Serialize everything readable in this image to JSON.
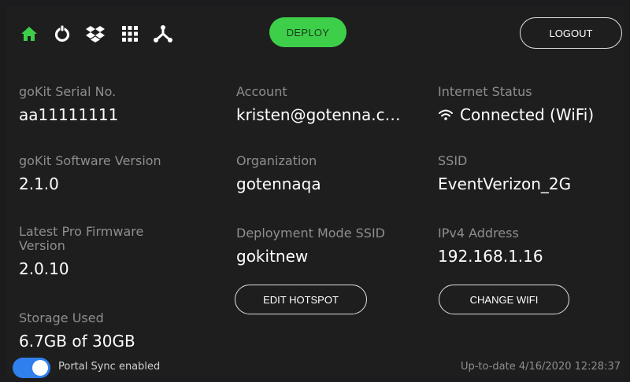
{
  "nav": {
    "icons": [
      "home-icon",
      "power-icon",
      "dropbox-icon",
      "grid-icon",
      "network-icon"
    ],
    "active_color": "#3ecf4a"
  },
  "deploy_label": "DEPLOY",
  "logout_label": "LOGOUT",
  "fields": {
    "serial_label": "goKit Serial No.",
    "serial_value": "aa11111111",
    "software_label": "goKit Software Version",
    "software_value": "2.1.0",
    "firmware_label": "Latest Pro Firmware Version",
    "firmware_value": "2.0.10",
    "storage_label": "Storage Used",
    "storage_value": "6.7GB of 30GB",
    "account_label": "Account",
    "account_value": "kristen@gotenna.c…",
    "org_label": "Organization",
    "org_value": "gotennaqa",
    "ssid_mode_label": "Deployment Mode SSID",
    "ssid_mode_value": "gokitnew",
    "internet_label": "Internet Status",
    "internet_value": "Connected (WiFi)",
    "ssid_label": "SSID",
    "ssid_value": "EventVerizon_2G",
    "ipv4_label": "IPv4 Address",
    "ipv4_value": "192.168.1.16"
  },
  "edit_hotspot_label": "EDIT HOTSPOT",
  "change_wifi_label": "CHANGE WIFI",
  "footer": {
    "sync_label": "Portal Sync enabled",
    "sync_on": true,
    "status": "Up-to-date 4/16/2020 12:28:37"
  },
  "colors": {
    "accent_green": "#3ecf4a",
    "toggle_blue": "#2f80ed",
    "background": "#1e1e1e"
  }
}
